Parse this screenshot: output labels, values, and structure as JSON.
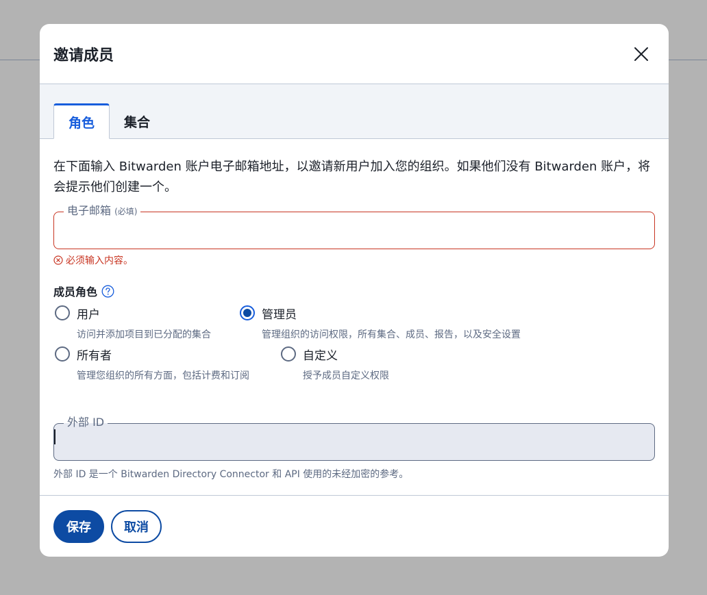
{
  "dialog": {
    "title": "邀请成员",
    "close_icon": "close-icon"
  },
  "tabs": [
    {
      "label": "角色",
      "active": true
    },
    {
      "label": "集合",
      "active": false
    }
  ],
  "description": "在下面输入 Bitwarden 账户电子邮箱地址，以邀请新用户加入您的组织。如果他们没有 Bitwarden 账户，将会提示他们创建一个。",
  "email": {
    "label": "电子邮箱",
    "required_tag": "(必填)",
    "value": "",
    "error": "必须输入内容。"
  },
  "member_role": {
    "title": "成员角色",
    "options": [
      {
        "label": "用户",
        "hint": "访问并添加项目到已分配的集合",
        "checked": false
      },
      {
        "label": "管理员",
        "hint": "管理组织的访问权限，所有集合、成员、报告，以及安全设置",
        "checked": true
      },
      {
        "label": "所有者",
        "hint": "管理您组织的所有方面，包括计费和订阅",
        "checked": false
      },
      {
        "label": "自定义",
        "hint": "授予成员自定义权限",
        "checked": false
      }
    ]
  },
  "external_id": {
    "label": "外部 ID",
    "value": "",
    "help": "外部 ID 是一个 Bitwarden Directory Connector 和 API 使用的未经加密的参考。"
  },
  "footer": {
    "save_label": "保存",
    "cancel_label": "取消"
  },
  "colors": {
    "primary": "#0d4ba3",
    "error": "#c83522",
    "muted": "#5d6a82"
  }
}
